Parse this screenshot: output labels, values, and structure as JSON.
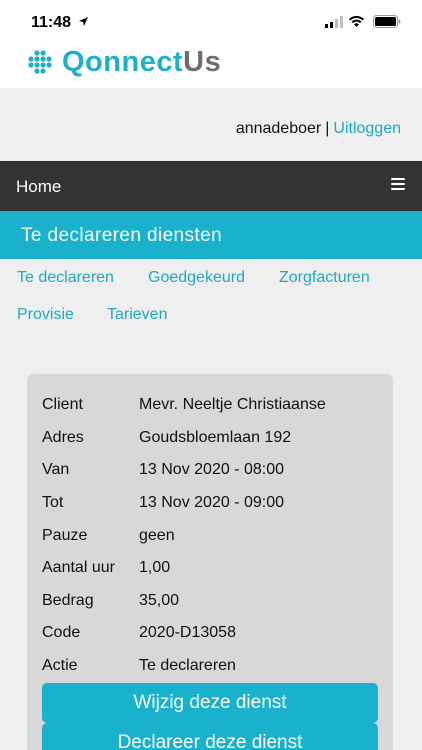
{
  "status_bar": {
    "time": "11:48"
  },
  "logo": {
    "part1": "Qonnect",
    "part2": "Us"
  },
  "user": {
    "username": "annadeboer",
    "separator": "|",
    "logout_label": "Uitloggen"
  },
  "nav": {
    "home_label": "Home"
  },
  "section": {
    "title": "Te declareren diensten"
  },
  "tabs": [
    "Te declareren",
    "Goedgekeurd",
    "Zorgfacturen",
    "Provisie",
    "Tarieven"
  ],
  "details": [
    {
      "label": "Client",
      "value": "Mevr. Neeltje Christiaanse"
    },
    {
      "label": "Adres",
      "value": "Goudsbloemlaan 192"
    },
    {
      "label": "Van",
      "value": "13 Nov 2020 - 08:00"
    },
    {
      "label": "Tot",
      "value": "13 Nov 2020 - 09:00"
    },
    {
      "label": "Pauze",
      "value": "geen"
    },
    {
      "label": "Aantal uur",
      "value": "1,00"
    },
    {
      "label": "Bedrag",
      "value": "35,00"
    },
    {
      "label": "Code",
      "value": "2020-D13058"
    },
    {
      "label": "Actie",
      "value": "Te declareren"
    }
  ],
  "buttons": {
    "edit": "Wijzig deze dienst",
    "declare": "Declareer deze dienst"
  },
  "colors": {
    "accent": "#1ab1cc",
    "nav": "#333333",
    "background": "#efefef",
    "card": "#d8d8d8"
  }
}
